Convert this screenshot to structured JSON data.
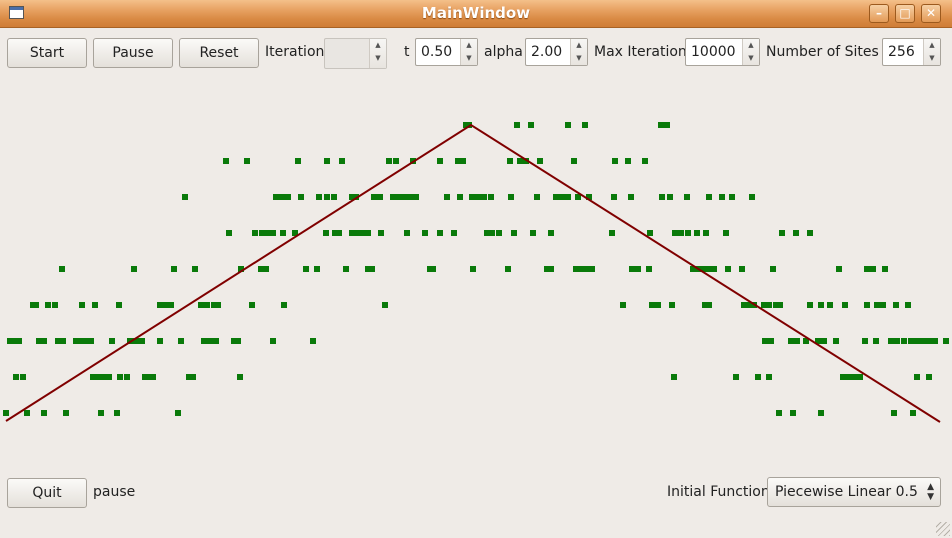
{
  "window": {
    "title": "MainWindow"
  },
  "toolbar": {
    "start_label": "Start",
    "pause_label": "Pause",
    "reset_label": "Reset",
    "iteration_label": "Iteration",
    "iteration_value": "",
    "t_label": "t",
    "t_value": "0.50",
    "alpha_label": "alpha",
    "alpha_value": "2.00",
    "max_iter_label": "Max Iteration",
    "max_iter_value": "10000",
    "sites_label": "Number of  Sites",
    "sites_value": "256"
  },
  "bottom": {
    "quit_label": "Quit",
    "status": "pause",
    "initial_function_label": "Initial Function",
    "initial_function_value": "Piecewise Linear 0.5"
  },
  "plot_data": {
    "line_color": "#800000",
    "dot_color": "#0a7a0a",
    "rows": [
      [
        466,
        469,
        517,
        531,
        568,
        585,
        661,
        667
      ],
      [
        226,
        247,
        298,
        327,
        342,
        389,
        396,
        413,
        440,
        458,
        463,
        510,
        520,
        526,
        540,
        574,
        615,
        628,
        645
      ],
      [
        185,
        276,
        282,
        288,
        301,
        319,
        327,
        334,
        352,
        356,
        374,
        380,
        393,
        399,
        405,
        411,
        416,
        447,
        460,
        472,
        478,
        484,
        491,
        511,
        537,
        556,
        562,
        568,
        578,
        589,
        614,
        631,
        662,
        670,
        687,
        709,
        722,
        732,
        752
      ],
      [
        229,
        255,
        262,
        267,
        273,
        283,
        295,
        326,
        335,
        339,
        352,
        357,
        363,
        368,
        381,
        407,
        425,
        440,
        454,
        487,
        492,
        499,
        514,
        533,
        551,
        612,
        650,
        675,
        681,
        688,
        697,
        706,
        726,
        782,
        796,
        810
      ],
      [
        62,
        134,
        174,
        195,
        241,
        261,
        266,
        306,
        317,
        346,
        368,
        372,
        430,
        433,
        473,
        508,
        547,
        551,
        576,
        581,
        587,
        592,
        632,
        638,
        649,
        693,
        699,
        705,
        709,
        714,
        728,
        742,
        773,
        839,
        867,
        873,
        885
      ],
      [
        33,
        36,
        48,
        55,
        82,
        95,
        119,
        160,
        165,
        171,
        201,
        207,
        214,
        218,
        252,
        284,
        385,
        623,
        652,
        658,
        672,
        705,
        709,
        744,
        749,
        754,
        764,
        769,
        776,
        780,
        810,
        821,
        830,
        845,
        867,
        877,
        883,
        896,
        908
      ],
      [
        10,
        14,
        19,
        39,
        44,
        58,
        63,
        76,
        80,
        86,
        91,
        112,
        130,
        136,
        142,
        160,
        181,
        204,
        210,
        216,
        234,
        238,
        273,
        313,
        765,
        771,
        791,
        797,
        806,
        818,
        824,
        836,
        865,
        876,
        891,
        897,
        904,
        911,
        917,
        923,
        929,
        935,
        946
      ],
      [
        16,
        23,
        93,
        99,
        104,
        109,
        120,
        127,
        145,
        149,
        153,
        189,
        193,
        240,
        674,
        736,
        758,
        769,
        843,
        849,
        855,
        860,
        917,
        929
      ],
      [
        6,
        27,
        44,
        66,
        101,
        117,
        178,
        779,
        793,
        821,
        894,
        913
      ]
    ]
  }
}
